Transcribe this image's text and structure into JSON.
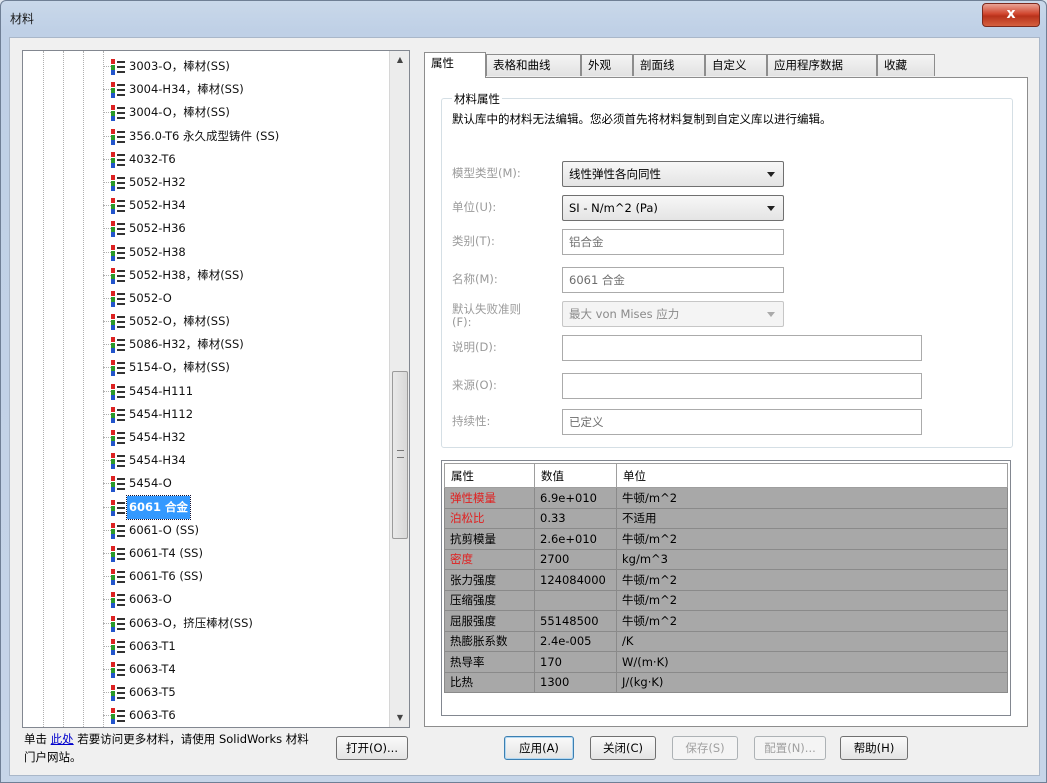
{
  "window": {
    "title": "材料",
    "close_label": "x"
  },
  "tree": {
    "items": [
      {
        "label": "3003-O，棒材(SS)",
        "selected": false
      },
      {
        "label": "3004-H34，棒材(SS)",
        "selected": false
      },
      {
        "label": "3004-O，棒材(SS)",
        "selected": false
      },
      {
        "label": "356.0-T6 永久成型铸件 (SS)",
        "selected": false
      },
      {
        "label": "4032-T6",
        "selected": false
      },
      {
        "label": "5052-H32",
        "selected": false
      },
      {
        "label": "5052-H34",
        "selected": false
      },
      {
        "label": "5052-H36",
        "selected": false
      },
      {
        "label": "5052-H38",
        "selected": false
      },
      {
        "label": "5052-H38，棒材(SS)",
        "selected": false
      },
      {
        "label": "5052-O",
        "selected": false
      },
      {
        "label": "5052-O，棒材(SS)",
        "selected": false
      },
      {
        "label": "5086-H32，棒材(SS)",
        "selected": false
      },
      {
        "label": "5154-O，棒材(SS)",
        "selected": false
      },
      {
        "label": "5454-H111",
        "selected": false
      },
      {
        "label": "5454-H112",
        "selected": false
      },
      {
        "label": "5454-H32",
        "selected": false
      },
      {
        "label": "5454-H34",
        "selected": false
      },
      {
        "label": "5454-O",
        "selected": false
      },
      {
        "label": "6061 合金",
        "selected": true
      },
      {
        "label": "6061-O (SS)",
        "selected": false
      },
      {
        "label": "6061-T4 (SS)",
        "selected": false
      },
      {
        "label": "6061-T6 (SS)",
        "selected": false
      },
      {
        "label": "6063-O",
        "selected": false
      },
      {
        "label": "6063-O，挤压棒材(SS)",
        "selected": false
      },
      {
        "label": "6063-T1",
        "selected": false
      },
      {
        "label": "6063-T4",
        "selected": false
      },
      {
        "label": "6063-T5",
        "selected": false
      },
      {
        "label": "6063-T6",
        "selected": false
      }
    ]
  },
  "footer": {
    "note_prefix": "单击 ",
    "note_link": "此处",
    "note_suffix": " 若要访问更多材料，请使用 SolidWorks 材料门户网站。",
    "open_button": "打开(O)..."
  },
  "tabs": [
    "属性",
    "表格和曲线",
    "外观",
    "剖面线",
    "自定义",
    "应用程序数据",
    "收藏"
  ],
  "properties": {
    "group_title": "材料属性",
    "description": "默认库中的材料无法编辑。您必须首先将材料复制到自定义库以进行编辑。",
    "model_type": {
      "label": "模型类型(M):",
      "value": "线性弹性各向同性"
    },
    "units": {
      "label": "单位(U):",
      "value": "SI - N/m^2 (Pa)"
    },
    "category": {
      "label": "类别(T):",
      "value": "铝合金"
    },
    "name": {
      "label": "名称(M):",
      "value": "6061 合金"
    },
    "failure": {
      "label": "默认失败准则(F):",
      "value": "最大 von Mises 应力"
    },
    "desc": {
      "label": "说明(D):",
      "value": ""
    },
    "source": {
      "label": "来源(O):",
      "value": ""
    },
    "sustainability": {
      "label": "持续性:",
      "value": "已定义"
    }
  },
  "table": {
    "headers": [
      "属性",
      "数值",
      "单位"
    ],
    "rows": [
      {
        "name": "弹性模量",
        "value": "6.9e+010",
        "unit": "牛顿/m^2",
        "required": true
      },
      {
        "name": "泊松比",
        "value": "0.33",
        "unit": "不适用",
        "required": true
      },
      {
        "name": "抗剪模量",
        "value": "2.6e+010",
        "unit": "牛顿/m^2",
        "required": false
      },
      {
        "name": "密度",
        "value": "2700",
        "unit": "kg/m^3",
        "required": true
      },
      {
        "name": "张力强度",
        "value": "124084000",
        "unit": "牛顿/m^2",
        "required": false
      },
      {
        "name": "压缩强度",
        "value": "",
        "unit": "牛顿/m^2",
        "required": false
      },
      {
        "name": "屈服强度",
        "value": "55148500",
        "unit": "牛顿/m^2",
        "required": false
      },
      {
        "name": "热膨胀系数",
        "value": "2.4e-005",
        "unit": "/K",
        "required": false
      },
      {
        "name": "热导率",
        "value": "170",
        "unit": "W/(m·K)",
        "required": false
      },
      {
        "name": "比热",
        "value": "1300",
        "unit": "J/(kg·K)",
        "required": false
      }
    ]
  },
  "buttons": {
    "apply": "应用(A)",
    "close": "关闭(C)",
    "save": "保存(S)",
    "config": "配置(N)...",
    "help": "帮助(H)"
  }
}
